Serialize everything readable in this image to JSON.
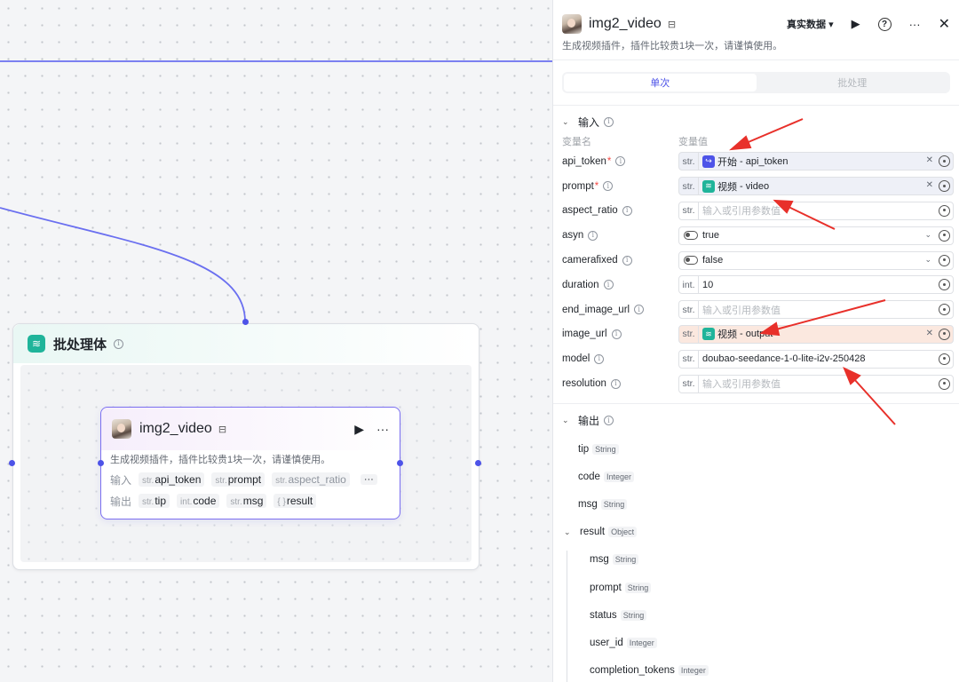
{
  "batch_node": {
    "title": "批处理体"
  },
  "inner_node": {
    "title": "img2_video",
    "desc": "生成视频插件，插件比较贵1块一次，请谨慎使用。",
    "input_label": "输入",
    "output_label": "输出",
    "inputs": [
      {
        "type": "str.",
        "name": "api_token"
      },
      {
        "type": "str.",
        "name": "prompt"
      },
      {
        "type": "str.",
        "name": "aspect_ratio"
      }
    ],
    "outputs": [
      {
        "type": "str.",
        "name": "tip"
      },
      {
        "type": "int.",
        "name": "code"
      },
      {
        "type": "str.",
        "name": "msg"
      },
      {
        "type": "{ }",
        "name": "result"
      }
    ],
    "more": "···"
  },
  "panel": {
    "title": "img2_video",
    "mode": "真实数据",
    "desc": "生成视频插件，插件比较贵1块一次，请谨慎使用。",
    "tabs": [
      "单次",
      "批处理"
    ],
    "input_section": "输入",
    "output_section": "输出",
    "col_name": "变量名",
    "col_value": "变量值",
    "params": [
      {
        "name": "api_token",
        "required": true,
        "type": "str.",
        "ref_source": "开始",
        "ref_var": "api_token"
      },
      {
        "name": "prompt",
        "required": true,
        "type": "str.",
        "ref_source": "视频",
        "ref_var": "video"
      },
      {
        "name": "aspect_ratio",
        "type": "str.",
        "placeholder": "输入或引用参数值"
      },
      {
        "name": "asyn",
        "type": "toggle",
        "value": "true"
      },
      {
        "name": "camerafixed",
        "type": "toggle",
        "value": "false"
      },
      {
        "name": "duration",
        "type": "int.",
        "value": "10"
      },
      {
        "name": "end_image_url",
        "type": "str.",
        "placeholder": "输入或引用参数值"
      },
      {
        "name": "image_url",
        "type": "str.",
        "ref_source": "视频",
        "ref_var": "output"
      },
      {
        "name": "model",
        "type": "str.",
        "value": "doubao-seedance-1-0-lite-i2v-250428"
      },
      {
        "name": "resolution",
        "type": "str.",
        "placeholder": "输入或引用参数值"
      }
    ],
    "outputs": [
      {
        "name": "tip",
        "type": "String"
      },
      {
        "name": "code",
        "type": "Integer"
      },
      {
        "name": "msg",
        "type": "String"
      },
      {
        "name": "result",
        "type": "Object"
      },
      {
        "name": "msg",
        "type": "String"
      },
      {
        "name": "prompt",
        "type": "String"
      },
      {
        "name": "status",
        "type": "String"
      },
      {
        "name": "user_id",
        "type": "Integer"
      },
      {
        "name": "completion_tokens",
        "type": "Integer"
      }
    ]
  },
  "colors": {
    "accent": "#4d53e8",
    "annotation": "#e8302a",
    "batch_icon": "#1fb49a"
  }
}
